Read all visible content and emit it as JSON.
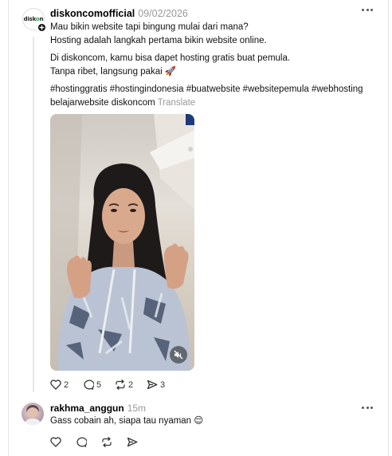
{
  "post": {
    "avatar_logo": "diskon",
    "username": "diskoncomofficial",
    "date": "09/02/2026",
    "lines_1": [
      "Mau bikin website tapi bingung mulai dari mana?",
      "Hosting adalah langkah pertama bikin website online."
    ],
    "lines_2": [
      "Di diskoncom, kamu bisa dapet hosting gratis buat pemula.",
      "Tanpa ribet, langsung pakai 🚀"
    ],
    "hashtags_line1": "#hostinggratis #hostingindonesia #buatwebsite #websitepemula #webhosting",
    "hashtags_line2": "belajarwebsite diskoncom",
    "translate": "Translate",
    "video_icon": "speaker-muted-icon",
    "likes": "2",
    "comments": "5",
    "reposts": "2",
    "shares": "3"
  },
  "reply": {
    "username": "rakhma_anggun",
    "time": "15m",
    "text": "Gass cobain ah, siapa tau nyaman 😌"
  },
  "colors": {
    "border": "#e5e5e5",
    "muted": "#999999",
    "brand_green": "#2e9e4c"
  }
}
